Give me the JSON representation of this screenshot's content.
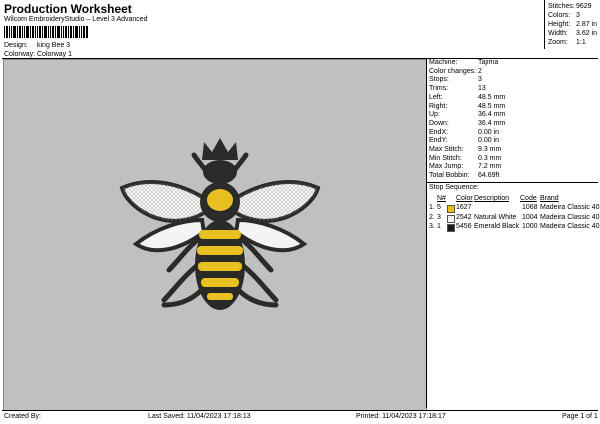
{
  "header": {
    "title": "Production Worksheet",
    "subtitle": "Wilcom EmbroideryStudio – Level 3 Advanced",
    "design_label": "Design:",
    "design_value": "king Bee 3",
    "colorway_label": "Colorway:",
    "colorway_value": "Colorway 1"
  },
  "top_right": {
    "stitches_label": "Stitches:",
    "stitches_value": "9629",
    "colors_label": "Colors:",
    "colors_value": "3",
    "height_label": "Height:",
    "height_value": "2.87 in",
    "width_label": "Width:",
    "width_value": "3.62 in",
    "zoom_label": "Zoom:",
    "zoom_value": "1:1"
  },
  "details": [
    {
      "label": "Machine:",
      "value": "Tajima"
    },
    {
      "label": "Color changes:",
      "value": "2"
    },
    {
      "label": "Stops:",
      "value": "3"
    },
    {
      "label": "Trims:",
      "value": "13"
    },
    {
      "label": "Left:",
      "value": "48.5 mm"
    },
    {
      "label": "Right:",
      "value": "48.5 mm"
    },
    {
      "label": "Up:",
      "value": "36.4 mm"
    },
    {
      "label": "Down:",
      "value": "36.4 mm"
    },
    {
      "label": "EndX:",
      "value": "0.00 in"
    },
    {
      "label": "EndY:",
      "value": "0.00 in"
    },
    {
      "label": "Max Stitch:",
      "value": "9.3 mm"
    },
    {
      "label": "Min Stitch:",
      "value": "0.3 mm"
    },
    {
      "label": "Max Jump:",
      "value": "7.2 mm"
    },
    {
      "label": "Total Bobbin:",
      "value": "64.69ft"
    }
  ],
  "stop_sequence": {
    "title": "Stop Sequence:",
    "headers": {
      "n": "N#",
      "color": "Color",
      "description": "Description",
      "code": "Code",
      "brand": "Brand"
    },
    "rows": [
      {
        "stop": "1.",
        "n": "5",
        "swatch": "#e8c020",
        "color": "1627",
        "description": "",
        "code": "1068",
        "brand": "Madeira Classic 40"
      },
      {
        "stop": "2.",
        "n": "3",
        "swatch": "#f4f4f4",
        "color": "2542",
        "description": "Natural White",
        "code": "1004",
        "brand": "Madeira Classic 40"
      },
      {
        "stop": "3.",
        "n": "1",
        "swatch": "#1a1a1a",
        "color": "5456",
        "description": "Emerald Black",
        "code": "1000",
        "brand": "Madeira Classic 40"
      }
    ]
  },
  "footer": {
    "created_by": "Created By:",
    "last_saved": "Last Saved: 11/04/2023 17:18:13",
    "printed": "Printed: 11/04/2023 17:18:17",
    "page": "Page 1 of 1"
  },
  "colors": {
    "canvas": "#c0c0c0",
    "bee_yellow": "#e8c020",
    "bee_black": "#2a2a28",
    "wing": "#f4f4f4"
  }
}
